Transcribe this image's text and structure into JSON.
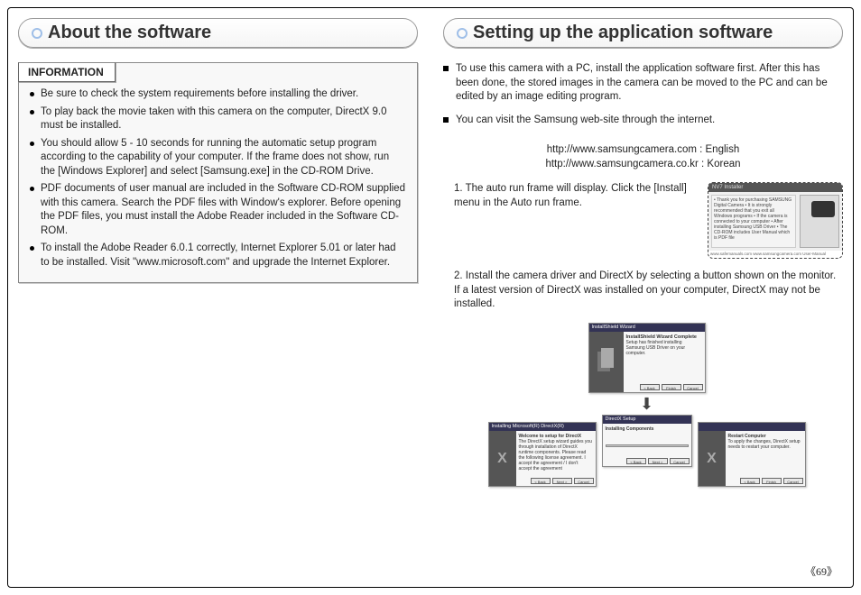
{
  "page_number": "《69》",
  "left": {
    "title": "About the software",
    "info_label": "INFORMATION",
    "bullets": [
      "Be sure to check the system requirements before installing the driver.",
      "To play back the movie taken with this camera on the computer, DirectX 9.0 must be installed.",
      "You should allow 5 - 10 seconds for running the automatic setup program according to the capability of your computer. If the frame does not show, run the [Windows Explorer] and select [Samsung.exe] in the CD-ROM Drive.",
      "PDF documents of user manual are included in the Software CD-ROM supplied with this camera. Search the PDF files with Window's explorer. Before opening the PDF files, you must install the Adobe Reader included in the Software CD-ROM.",
      "To install the Adobe Reader 6.0.1 correctly, Internet Explorer 5.01 or later had to be installed. Visit \"www.microsoft.com\" and upgrade the Internet Explorer."
    ]
  },
  "right": {
    "title": "Setting up the application software",
    "squares": [
      "To use this camera with a PC, install the application software first. After this has been done, the stored images in the camera can be moved to the PC and can be edited by an image editing program.",
      "You can visit the Samsung web-site through the internet."
    ],
    "url_en": "http://www.samsungcamera.com : English",
    "url_kr": "http://www.samsungcamera.co.kr : Korean",
    "step1": "1. The auto run frame will display. Click the [Install] menu in the Auto run frame.",
    "step2": "2. Install the camera driver and DirectX by selecting a button shown on the monitor. If a latest version of DirectX was installed on your computer, DirectX may not be installed.",
    "thumb_installer_title": "NV7 Installer",
    "thumb_installer_lines": "• Thank you for purchasing SAMSUNG Digital Camera\n• It is strongly recommended that you exit all Windows programs\n• If the camera is connected to your computer\n• After installing Samsung USB Driver\n• The CD-ROM includes User Manual which is PDF file",
    "thumb_installer_footer": "www.safemanuals.com    www.samsungcamera.com    User-Manual",
    "dlg_wizard_title": "InstallShield Wizard",
    "dlg_wizard_head": "InstallShield Wizard Complete",
    "dlg_wizard_body": "Setup has finished installing Samsung USB Driver on your computer.",
    "dlg_dx1_title": "Installing Microsoft(R) DirectX(R)",
    "dlg_dx1_head": "Welcome to setup for DirectX",
    "dlg_dx1_body": "The DirectX setup wizard guides you through installation of DirectX runtime components. Please read the following license agreement. I accept the agreement / I don't accept the agreement",
    "dlg_dx2_title": "DirectX Setup",
    "dlg_dx2_head": "Installing Components",
    "dlg_dx3_title": "",
    "dlg_dx3_head": "Restart Computer",
    "dlg_dx3_body": "To apply the changes, DirectX setup needs to restart your computer.",
    "btn_back": "< Back",
    "btn_next": "Next >",
    "btn_cancel": "Cancel",
    "btn_finish": "Finish"
  }
}
